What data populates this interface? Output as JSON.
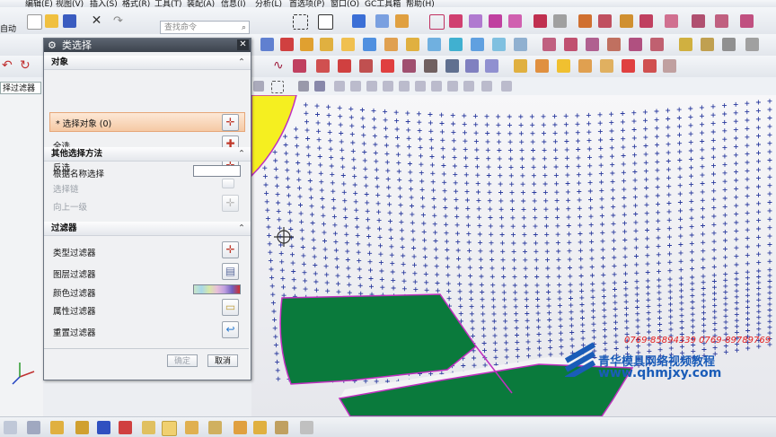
{
  "menu": [
    "编辑(E)",
    "视图(V)",
    "插入(S)",
    "格式(R)",
    "工具(T)",
    "装配(A)",
    "信息(I)",
    "分析(L)",
    "首选项(P)",
    "窗口(O)",
    "GC工具箱",
    "帮助(H)"
  ],
  "toolbar": {
    "left_label": "自动",
    "search_placeholder": "查找命令",
    "search_icon": "magnifier-icon",
    "filter_label": "择过滤器"
  },
  "dialog": {
    "title": "类选择",
    "sections": {
      "object": "对象",
      "other": "其他选择方法",
      "filter": "过滤器"
    },
    "select_object": "* 选择对象 (0)",
    "select_all": "全选",
    "invert": "反选",
    "select_by_name": "根据名称选择",
    "select_chain": "选择链",
    "up_one_level": "向上一级",
    "type_filter": "类型过滤器",
    "layer_filter": "图层过滤器",
    "color_filter": "颜色过滤器",
    "attribute_filter": "属性过滤器",
    "reset_filter": "重置过滤器",
    "ok": "确定",
    "cancel": "取消"
  },
  "watermark": {
    "phone": "0769-85894339  0769-89789769",
    "brand": "青华模具网络视频教程",
    "site": "www.qhmjxy.com"
  },
  "colors": {
    "surface_green": "#0a7a3c",
    "mesh_blue": "#2b3b9e",
    "edge_magenta": "#c030c0",
    "highlight_yellow": "#f5ef20",
    "watermark_blue": "#1a5cb8",
    "watermark_red": "#e52020"
  }
}
